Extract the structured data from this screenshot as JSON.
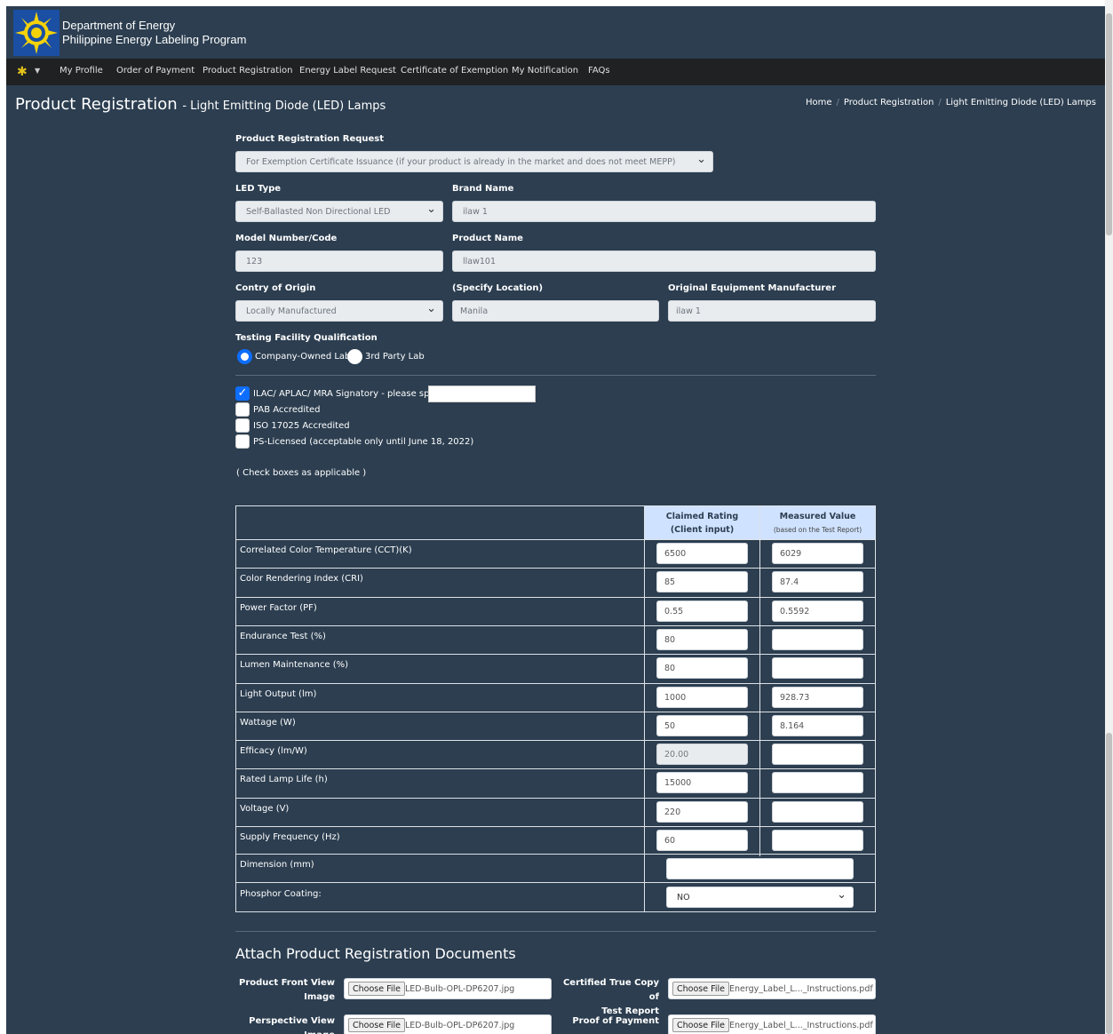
{
  "header": {
    "org_line1": "Department of Energy",
    "org_line2": "Philippine Energy Labeling Program"
  },
  "nav": {
    "items": [
      "My Profile",
      "Order of Payment",
      "Product Registration",
      "Energy Label Request",
      "Certificate of Exemption",
      "My Notification",
      "FAQs"
    ]
  },
  "page": {
    "title": "Product Registration",
    "subtitle": "- Light Emitting Diode (LED) Lamps"
  },
  "breadcrumb": [
    "Home",
    "Product Registration",
    "Light Emitting Diode (LED) Lamps"
  ],
  "form": {
    "request_label": "Product Registration Request",
    "request_value": "For Exemption Certificate Issuance (if your product is already in the market and does not meet MEPP)",
    "led_type_label": "LED Type",
    "led_type_value": "Self-Ballasted Non Directional LED",
    "brand_label": "Brand Name",
    "brand_value": "ilaw 1",
    "model_label": "Model Number/Code",
    "model_value": "123",
    "product_label": "Product Name",
    "product_value": "llaw101",
    "origin_label": "Contry of Origin",
    "origin_value": "Locally Manufactured",
    "location_label": "(Specify Location)",
    "location_value": "Manila",
    "oem_label": "Original Equipment Manufacturer",
    "oem_value": "ilaw 1",
    "testing_label": "Testing Facility Qualification",
    "radio_company": "Company-Owned Lab",
    "radio_third": "3rd Party Lab",
    "cb_ilac": "ILAC/ APLAC/ MRA Signatory - please specify",
    "cb_pab": "PAB Accredited",
    "cb_iso": "ISO 17025 Accredited",
    "cb_ps": "PS-Licensed (acceptable only until June 18, 2022)",
    "check_note": "( Check boxes as applicable )"
  },
  "table": {
    "col_claimed": "Claimed Rating",
    "col_claimed_sub": "(Client input)",
    "col_measured": "Measured Value",
    "col_measured_sub": "(based on the Test Report)",
    "rows": [
      {
        "label": "Correlated Color Temperature (CCT)(K)",
        "claimed": "6500",
        "measured": "6029"
      },
      {
        "label": "Color Rendering Index (CRI)",
        "claimed": "85",
        "measured": "87.4"
      },
      {
        "label": "Power Factor (PF)",
        "claimed": "0.55",
        "measured": "0.5592"
      },
      {
        "label": "Endurance Test (%)",
        "claimed": "80",
        "measured": ""
      },
      {
        "label": "Lumen Maintenance (%)",
        "claimed": "80",
        "measured": ""
      },
      {
        "label": "Light Output (lm)",
        "claimed": "1000",
        "measured": "928.73"
      },
      {
        "label": "Wattage (W)",
        "claimed": "50",
        "measured": "8.164"
      },
      {
        "label": "Efficacy (lm/W)",
        "claimed": "20.00",
        "measured": ""
      },
      {
        "label": "Rated Lamp Life (h)",
        "claimed": "15000",
        "measured": ""
      },
      {
        "label": "Voltage (V)",
        "claimed": "220",
        "measured": ""
      },
      {
        "label": "Supply Frequency (Hz)",
        "claimed": "60",
        "measured": ""
      }
    ],
    "dimension_label": "Dimension (mm)",
    "dimension_value": "",
    "phosphor_label": "Phosphor Coating:",
    "phosphor_value": "NO"
  },
  "attach": {
    "title": "Attach Product Registration Documents",
    "choose_label": "Choose File",
    "front_label_1": "Product Front View",
    "front_label_2": "Image",
    "front_file": "LED-Bulb-OPL-DP6207.jpg",
    "perspective_label": "Perspective View Image",
    "perspective_file": "LED-Bulb-OPL-DP6207.jpg",
    "certified_label_1": "Certified True Copy of",
    "certified_label_2": "Test Report",
    "certified_file": "Energy_Label_L..._Instructions.pdf",
    "payment_label": "Proof of Payment",
    "payment_file": "Energy_Label_L..._Instructions.pdf"
  }
}
